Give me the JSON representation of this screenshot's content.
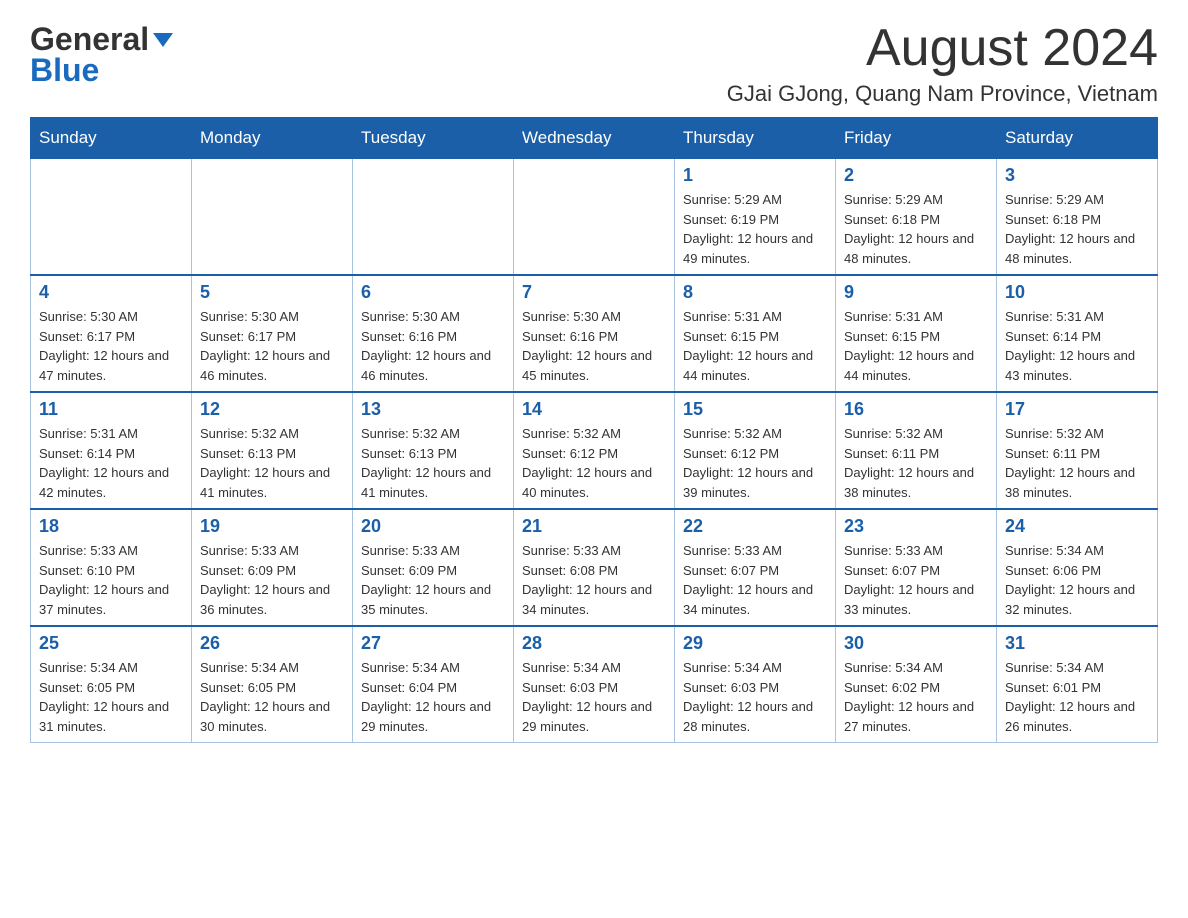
{
  "header": {
    "logo_general": "General",
    "logo_blue": "Blue",
    "month_title": "August 2024",
    "location": "GJai GJong, Quang Nam Province, Vietnam"
  },
  "days_of_week": [
    "Sunday",
    "Monday",
    "Tuesday",
    "Wednesday",
    "Thursday",
    "Friday",
    "Saturday"
  ],
  "weeks": [
    [
      {
        "day": "",
        "sunrise": "",
        "sunset": "",
        "daylight": ""
      },
      {
        "day": "",
        "sunrise": "",
        "sunset": "",
        "daylight": ""
      },
      {
        "day": "",
        "sunrise": "",
        "sunset": "",
        "daylight": ""
      },
      {
        "day": "",
        "sunrise": "",
        "sunset": "",
        "daylight": ""
      },
      {
        "day": "1",
        "sunrise": "Sunrise: 5:29 AM",
        "sunset": "Sunset: 6:19 PM",
        "daylight": "Daylight: 12 hours and 49 minutes."
      },
      {
        "day": "2",
        "sunrise": "Sunrise: 5:29 AM",
        "sunset": "Sunset: 6:18 PM",
        "daylight": "Daylight: 12 hours and 48 minutes."
      },
      {
        "day": "3",
        "sunrise": "Sunrise: 5:29 AM",
        "sunset": "Sunset: 6:18 PM",
        "daylight": "Daylight: 12 hours and 48 minutes."
      }
    ],
    [
      {
        "day": "4",
        "sunrise": "Sunrise: 5:30 AM",
        "sunset": "Sunset: 6:17 PM",
        "daylight": "Daylight: 12 hours and 47 minutes."
      },
      {
        "day": "5",
        "sunrise": "Sunrise: 5:30 AM",
        "sunset": "Sunset: 6:17 PM",
        "daylight": "Daylight: 12 hours and 46 minutes."
      },
      {
        "day": "6",
        "sunrise": "Sunrise: 5:30 AM",
        "sunset": "Sunset: 6:16 PM",
        "daylight": "Daylight: 12 hours and 46 minutes."
      },
      {
        "day": "7",
        "sunrise": "Sunrise: 5:30 AM",
        "sunset": "Sunset: 6:16 PM",
        "daylight": "Daylight: 12 hours and 45 minutes."
      },
      {
        "day": "8",
        "sunrise": "Sunrise: 5:31 AM",
        "sunset": "Sunset: 6:15 PM",
        "daylight": "Daylight: 12 hours and 44 minutes."
      },
      {
        "day": "9",
        "sunrise": "Sunrise: 5:31 AM",
        "sunset": "Sunset: 6:15 PM",
        "daylight": "Daylight: 12 hours and 44 minutes."
      },
      {
        "day": "10",
        "sunrise": "Sunrise: 5:31 AM",
        "sunset": "Sunset: 6:14 PM",
        "daylight": "Daylight: 12 hours and 43 minutes."
      }
    ],
    [
      {
        "day": "11",
        "sunrise": "Sunrise: 5:31 AM",
        "sunset": "Sunset: 6:14 PM",
        "daylight": "Daylight: 12 hours and 42 minutes."
      },
      {
        "day": "12",
        "sunrise": "Sunrise: 5:32 AM",
        "sunset": "Sunset: 6:13 PM",
        "daylight": "Daylight: 12 hours and 41 minutes."
      },
      {
        "day": "13",
        "sunrise": "Sunrise: 5:32 AM",
        "sunset": "Sunset: 6:13 PM",
        "daylight": "Daylight: 12 hours and 41 minutes."
      },
      {
        "day": "14",
        "sunrise": "Sunrise: 5:32 AM",
        "sunset": "Sunset: 6:12 PM",
        "daylight": "Daylight: 12 hours and 40 minutes."
      },
      {
        "day": "15",
        "sunrise": "Sunrise: 5:32 AM",
        "sunset": "Sunset: 6:12 PM",
        "daylight": "Daylight: 12 hours and 39 minutes."
      },
      {
        "day": "16",
        "sunrise": "Sunrise: 5:32 AM",
        "sunset": "Sunset: 6:11 PM",
        "daylight": "Daylight: 12 hours and 38 minutes."
      },
      {
        "day": "17",
        "sunrise": "Sunrise: 5:32 AM",
        "sunset": "Sunset: 6:11 PM",
        "daylight": "Daylight: 12 hours and 38 minutes."
      }
    ],
    [
      {
        "day": "18",
        "sunrise": "Sunrise: 5:33 AM",
        "sunset": "Sunset: 6:10 PM",
        "daylight": "Daylight: 12 hours and 37 minutes."
      },
      {
        "day": "19",
        "sunrise": "Sunrise: 5:33 AM",
        "sunset": "Sunset: 6:09 PM",
        "daylight": "Daylight: 12 hours and 36 minutes."
      },
      {
        "day": "20",
        "sunrise": "Sunrise: 5:33 AM",
        "sunset": "Sunset: 6:09 PM",
        "daylight": "Daylight: 12 hours and 35 minutes."
      },
      {
        "day": "21",
        "sunrise": "Sunrise: 5:33 AM",
        "sunset": "Sunset: 6:08 PM",
        "daylight": "Daylight: 12 hours and 34 minutes."
      },
      {
        "day": "22",
        "sunrise": "Sunrise: 5:33 AM",
        "sunset": "Sunset: 6:07 PM",
        "daylight": "Daylight: 12 hours and 34 minutes."
      },
      {
        "day": "23",
        "sunrise": "Sunrise: 5:33 AM",
        "sunset": "Sunset: 6:07 PM",
        "daylight": "Daylight: 12 hours and 33 minutes."
      },
      {
        "day": "24",
        "sunrise": "Sunrise: 5:34 AM",
        "sunset": "Sunset: 6:06 PM",
        "daylight": "Daylight: 12 hours and 32 minutes."
      }
    ],
    [
      {
        "day": "25",
        "sunrise": "Sunrise: 5:34 AM",
        "sunset": "Sunset: 6:05 PM",
        "daylight": "Daylight: 12 hours and 31 minutes."
      },
      {
        "day": "26",
        "sunrise": "Sunrise: 5:34 AM",
        "sunset": "Sunset: 6:05 PM",
        "daylight": "Daylight: 12 hours and 30 minutes."
      },
      {
        "day": "27",
        "sunrise": "Sunrise: 5:34 AM",
        "sunset": "Sunset: 6:04 PM",
        "daylight": "Daylight: 12 hours and 29 minutes."
      },
      {
        "day": "28",
        "sunrise": "Sunrise: 5:34 AM",
        "sunset": "Sunset: 6:03 PM",
        "daylight": "Daylight: 12 hours and 29 minutes."
      },
      {
        "day": "29",
        "sunrise": "Sunrise: 5:34 AM",
        "sunset": "Sunset: 6:03 PM",
        "daylight": "Daylight: 12 hours and 28 minutes."
      },
      {
        "day": "30",
        "sunrise": "Sunrise: 5:34 AM",
        "sunset": "Sunset: 6:02 PM",
        "daylight": "Daylight: 12 hours and 27 minutes."
      },
      {
        "day": "31",
        "sunrise": "Sunrise: 5:34 AM",
        "sunset": "Sunset: 6:01 PM",
        "daylight": "Daylight: 12 hours and 26 minutes."
      }
    ]
  ]
}
